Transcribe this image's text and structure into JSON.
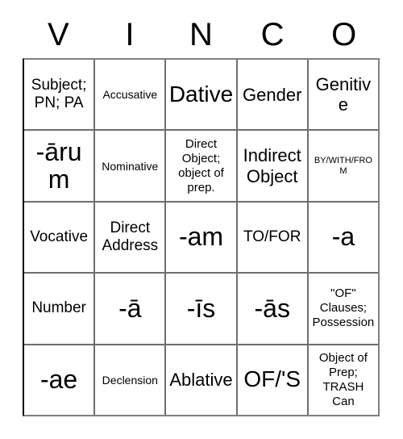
{
  "card": {
    "title_letters": [
      "V",
      "I",
      "N",
      "C",
      "O"
    ],
    "columns": 5,
    "rows": 5,
    "colors": {
      "background": "#ffffff",
      "text": "#000000",
      "grid_line": "#6e6e6e",
      "border": "#000000"
    },
    "cells": [
      [
        {
          "text": "Subject;\nPN; PA",
          "size": "lg"
        },
        {
          "text": "Accusative",
          "size": "sm"
        },
        {
          "text": "Dative",
          "size": "xxl"
        },
        {
          "text": "Gender",
          "size": "xl"
        },
        {
          "text": "Genitive",
          "size": "xl"
        }
      ],
      [
        {
          "text": "-ārum",
          "size": "huge"
        },
        {
          "text": "Nominative",
          "size": "sm"
        },
        {
          "text": "Direct\nObject;\nobject of\nprep.",
          "size": "md"
        },
        {
          "text": "Indirect\nObject",
          "size": "xl"
        },
        {
          "text": "BY/WITH/FROM",
          "size": "xs"
        }
      ],
      [
        {
          "text": "Vocative",
          "size": "lg"
        },
        {
          "text": "Direct\nAddress",
          "size": "lg"
        },
        {
          "text": "-am",
          "size": "huge"
        },
        {
          "text": "TO/FOR",
          "size": "lg"
        },
        {
          "text": "-a",
          "size": "huge"
        }
      ],
      [
        {
          "text": "Number",
          "size": "lg"
        },
        {
          "text": "-ā",
          "size": "huge"
        },
        {
          "text": "-īs",
          "size": "huge"
        },
        {
          "text": "-ās",
          "size": "huge"
        },
        {
          "text": "\"OF\"\nClauses;\nPossession",
          "size": "md"
        }
      ],
      [
        {
          "text": "-ae",
          "size": "huge"
        },
        {
          "text": "Declension",
          "size": "sm"
        },
        {
          "text": "Ablative",
          "size": "xl"
        },
        {
          "text": "OF/'S",
          "size": "xxl"
        },
        {
          "text": "Object of\nPrep;\nTRASH\nCan",
          "size": "md"
        }
      ]
    ]
  }
}
